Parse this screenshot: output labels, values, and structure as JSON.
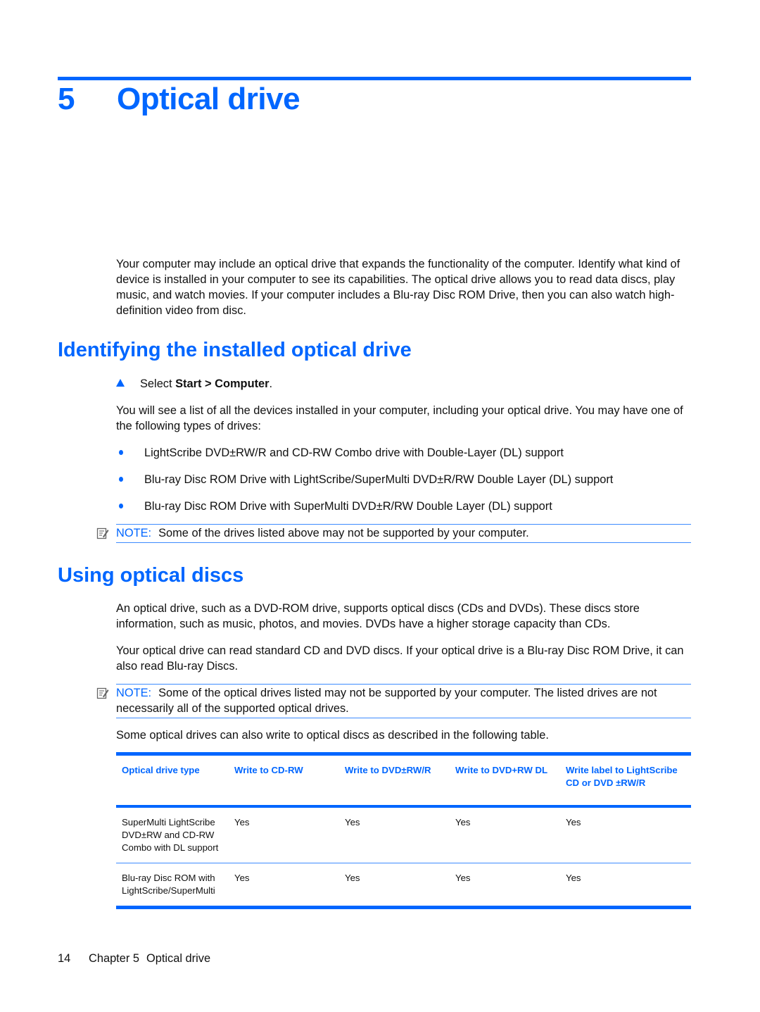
{
  "chapter": {
    "number": "5",
    "title": "Optical drive",
    "intro": "Your computer may include an optical drive that expands the functionality of the computer. Identify what kind of device is installed in your computer to see its capabilities. The optical drive allows you to read data discs, play music, and watch movies. If your computer includes a Blu-ray Disc ROM Drive, then you can also watch high-definition video from disc."
  },
  "section_identify": {
    "heading": "Identifying the installed optical drive",
    "step": {
      "prefix": "Select ",
      "bold": "Start > Computer",
      "suffix": "."
    },
    "para": "You will see a list of all the devices installed in your computer, including your optical drive. You may have one of the following types of drives:",
    "bullets": [
      "LightScribe DVD±RW/R and CD-RW Combo drive with Double-Layer (DL) support",
      "Blu-ray Disc ROM Drive with LightScribe/SuperMulti DVD±R/RW Double Layer (DL) support",
      "Blu-ray Disc ROM Drive with SuperMulti DVD±R/RW Double Layer (DL) support"
    ],
    "note": {
      "label": "NOTE:",
      "text": "Some of the drives listed above may not be supported by your computer."
    }
  },
  "section_using": {
    "heading": "Using optical discs",
    "para1": "An optical drive, such as a DVD-ROM drive, supports optical discs (CDs and DVDs). These discs store information, such as music, photos, and movies. DVDs have a higher storage capacity than CDs.",
    "para2": "Your optical drive can read standard CD and DVD discs. If your optical drive is a Blu-ray Disc ROM Drive, it can also read Blu-ray Discs.",
    "note": {
      "label": "NOTE:",
      "text": "Some of the optical drives listed may not be supported by your computer. The listed drives are not necessarily all of the supported optical drives."
    },
    "para3": "Some optical drives can also write to optical discs as described in the following table."
  },
  "table": {
    "headers": [
      "Optical drive type",
      "Write to CD-RW",
      "Write to DVD±RW/R",
      "Write to DVD+RW DL",
      "Write label to LightScribe CD or DVD ±RW/R"
    ],
    "rows": [
      [
        "SuperMulti LightScribe DVD±RW and CD-RW Combo with DL support",
        "Yes",
        "Yes",
        "Yes",
        "Yes"
      ],
      [
        "Blu-ray Disc ROM with LightScribe/SuperMulti",
        "Yes",
        "Yes",
        "Yes",
        "Yes"
      ]
    ]
  },
  "footer": {
    "page_number": "14",
    "chapter_label": "Chapter 5",
    "chapter_title": "Optical drive"
  },
  "colors": {
    "accent": "#0066ff",
    "text": "#111111"
  }
}
